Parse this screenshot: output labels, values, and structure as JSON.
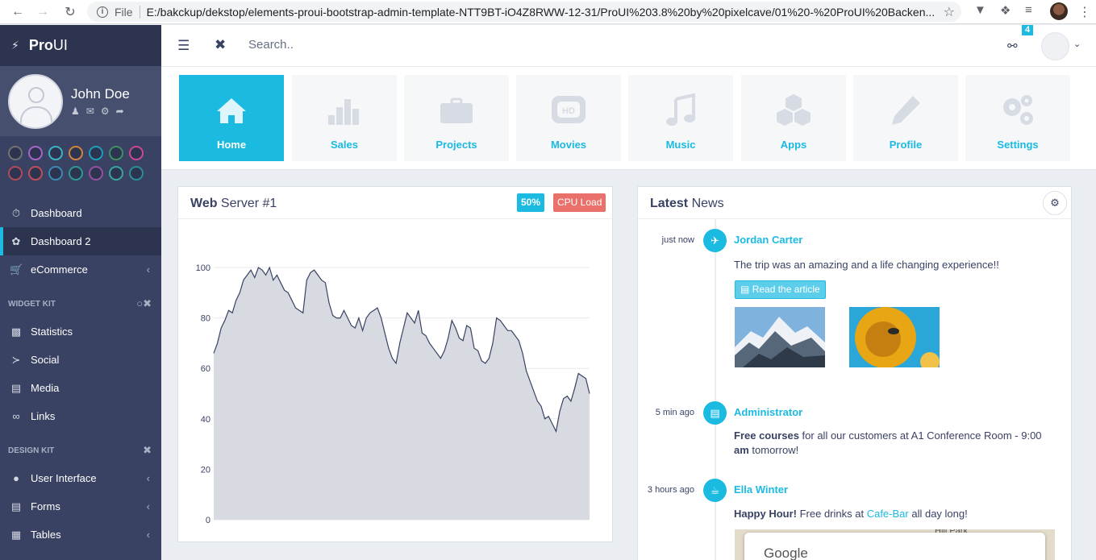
{
  "browser": {
    "file_label": "File",
    "url": "E:/bakckup/dekstop/elements-proui-bootstrap-admin-template-NTT9BT-iO4Z8RWW-12-31/ProUI%203.8%20by%20pixelcave/01%20-%20ProUI%20Backen..."
  },
  "brand": {
    "pro": "Pro",
    "ui": "UI"
  },
  "user": {
    "name": "John Doe"
  },
  "theme_colors": [
    "#727272",
    "#a965c9",
    "#3ab4c4",
    "#d2843f",
    "#1d9fb8",
    "#3f9063",
    "#cb4893",
    "#b14a5a",
    "#c44c59",
    "#3a8ab4",
    "#2a9b8f",
    "#95509f",
    "#3aa4a0",
    "#2a8f96"
  ],
  "sidebar": {
    "items": [
      {
        "label": "Dashboard",
        "icon": "stopwatch-icon"
      },
      {
        "label": "Dashboard 2",
        "icon": "leaf-icon"
      },
      {
        "label": "eCommerce",
        "icon": "cart-icon"
      }
    ],
    "widget_kit_header": "WIDGET KIT",
    "widget_items": [
      {
        "label": "Statistics",
        "icon": "bar-chart-icon"
      },
      {
        "label": "Social",
        "icon": "share-icon"
      },
      {
        "label": "Media",
        "icon": "film-icon"
      },
      {
        "label": "Links",
        "icon": "link-icon"
      }
    ],
    "design_kit_header": "DESIGN KIT",
    "design_items": [
      {
        "label": "User Interface",
        "icon": "brush-icon"
      },
      {
        "label": "Forms",
        "icon": "clipboard-icon"
      },
      {
        "label": "Tables",
        "icon": "table-icon"
      }
    ]
  },
  "header": {
    "search_placeholder": "Search..",
    "notif_count": "4"
  },
  "tiles": [
    {
      "label": "Home"
    },
    {
      "label": "Sales"
    },
    {
      "label": "Projects"
    },
    {
      "label": "Movies"
    },
    {
      "label": "Music"
    },
    {
      "label": "Apps"
    },
    {
      "label": "Profile"
    },
    {
      "label": "Settings"
    }
  ],
  "server_widget": {
    "title_bold": "Web",
    "title_rest": " Server #1",
    "badge_percent": "50%",
    "badge_label": "CPU Load"
  },
  "chart_data": {
    "type": "area",
    "title": "",
    "xlabel": "",
    "ylabel": "",
    "ylim": [
      0,
      100
    ],
    "yticks": [
      0,
      20,
      40,
      60,
      80,
      100
    ],
    "grid": true,
    "y": [
      66,
      70,
      76,
      79,
      83,
      82,
      87,
      90,
      95,
      97,
      99,
      96,
      100,
      99,
      97,
      100,
      95,
      97,
      94,
      91,
      90,
      87,
      84,
      83,
      82,
      95,
      98,
      99,
      97,
      95,
      94,
      86,
      81,
      80,
      80,
      83,
      80,
      77,
      76,
      80,
      75,
      80,
      82,
      83,
      84,
      80,
      74,
      68,
      64,
      62,
      70,
      76,
      82,
      80,
      78,
      83,
      74,
      73,
      70,
      68,
      66,
      64,
      67,
      72,
      79,
      76,
      72,
      71,
      77,
      76,
      68,
      67,
      63,
      62,
      64,
      70,
      80,
      79,
      77,
      75,
      75,
      73,
      71,
      66,
      59,
      55,
      51,
      47,
      45,
      40,
      41,
      38,
      35,
      43,
      48,
      49,
      47,
      52,
      58,
      57,
      56,
      50
    ]
  },
  "news_widget": {
    "title_bold": "Latest",
    "title_rest": " News",
    "items": [
      {
        "time": "just now",
        "author": "Jordan Carter",
        "text": "The trip was an amazing and a life changing experience!!",
        "button": "Read the article",
        "icon": "airplane-icon"
      },
      {
        "time": "5 min ago",
        "author": "Administrator",
        "bold1": "Free courses",
        "text1": " for all our customers at A1 Conference Room - 9:00 ",
        "bold2": "am",
        "text2": " tomorrow!",
        "icon": "document-icon"
      },
      {
        "time": "3 hours ago",
        "author": "Ella Winter",
        "bold1": "Happy Hour!",
        "text1": " Free drinks at ",
        "link": "Cafe-Bar",
        "text2": " all day long!",
        "icon": "drink-icon"
      }
    ],
    "map_label": "Google",
    "map_place": "Hill Park"
  }
}
